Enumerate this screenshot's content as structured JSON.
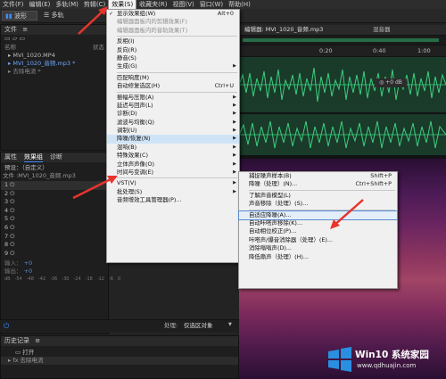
{
  "menubar": {
    "items": [
      {
        "label": "文件(F)"
      },
      {
        "label": "编辑(E)"
      },
      {
        "label": "多轨(M)"
      },
      {
        "label": "剪辑(C)"
      },
      {
        "label": "效果(S)"
      },
      {
        "label": "收藏夹(R)"
      },
      {
        "label": "视图(V)"
      },
      {
        "label": "窗口(W)"
      },
      {
        "label": "帮助(H)"
      }
    ]
  },
  "toolbar": {
    "waveform_label": "波形",
    "multitrack_label": "多轨"
  },
  "files_panel": {
    "title": "文件",
    "col_name": "名称",
    "col_status": "状态",
    "items": [
      "MVI_1020.MP4",
      "MVI_1020_音频.mp3 *",
      "去除电流 *"
    ]
  },
  "effects_panel": {
    "tabs": [
      "属性",
      "效果组",
      "诊断"
    ],
    "preset_label": "预设：（自定义）",
    "file_label": "文件 :MVI_1020_音频.mp3",
    "slots": [
      "1",
      "2",
      "3",
      "4",
      "5",
      "6",
      "7",
      "8",
      "9"
    ],
    "db_ticks": [
      "dB",
      "-54",
      "-48",
      "-42",
      "-36",
      "-30",
      "-24",
      "-18",
      "-12",
      "-6",
      "0"
    ],
    "process_label": "处理:",
    "process_value": "仅选区对象",
    "input_label": "输入：",
    "output_label": "输出：",
    "gain_value": "+0"
  },
  "history_panel": {
    "title": "历史记录",
    "items": [
      "打开",
      "去除电流"
    ]
  },
  "editor": {
    "tab1": "编辑器: MVI_1020_音频.mp3",
    "tab2": "混音器",
    "timecodes": [
      "0:20",
      "0:40",
      "1:00"
    ],
    "hud": "+0 dB"
  },
  "effects_menu": {
    "items": [
      {
        "label": "显示效果组(W)",
        "shortcut": "Alt+0",
        "check": "✓"
      },
      {
        "label": "编辑器面板内的剪辑效果(F)",
        "shortcut": "",
        "disabled": true
      },
      {
        "label": "编辑器面板内的音轨效果(T)",
        "shortcut": "",
        "disabled": true
      },
      {
        "sep": true
      },
      {
        "label": "反相(I)",
        "shortcut": ""
      },
      {
        "label": "反向(R)",
        "shortcut": ""
      },
      {
        "label": "静音(S)",
        "shortcut": ""
      },
      {
        "label": "生成(G)",
        "shortcut": "",
        "sub": true
      },
      {
        "sep": true
      },
      {
        "label": "匹配响度(M)",
        "shortcut": ""
      },
      {
        "label": "自动修复选区(H)",
        "shortcut": "Ctrl+U"
      },
      {
        "sep": true
      },
      {
        "label": "振幅与压限(A)",
        "shortcut": "",
        "sub": true
      },
      {
        "label": "延迟与回声(L)",
        "shortcut": "",
        "sub": true
      },
      {
        "label": "诊断(D)",
        "shortcut": "",
        "sub": true
      },
      {
        "label": "滤波与均衡(Q)",
        "shortcut": "",
        "sub": true
      },
      {
        "label": "调制(U)",
        "shortcut": "",
        "sub": true
      },
      {
        "label": "降噪/恢复(N)",
        "shortcut": "",
        "sub": true,
        "highlight": true
      },
      {
        "label": "混响(B)",
        "shortcut": "",
        "sub": true
      },
      {
        "label": "特殊效果(C)",
        "shortcut": "",
        "sub": true
      },
      {
        "label": "立体声声像(O)",
        "shortcut": "",
        "sub": true
      },
      {
        "label": "时间与变调(E)",
        "shortcut": "",
        "sub": true
      },
      {
        "sep": true
      },
      {
        "label": "VST(V)",
        "shortcut": "",
        "sub": true
      },
      {
        "label": "批处理(S)",
        "shortcut": "",
        "sub": true
      },
      {
        "label": "音频增效工具管理器(P)...",
        "shortcut": ""
      }
    ]
  },
  "noise_submenu": {
    "items": [
      {
        "label": "捕捉噪声样本(B)",
        "shortcut": "Shift+P"
      },
      {
        "label": "降噪（处理）(N)...",
        "shortcut": "Ctrl+Shift+P"
      },
      {
        "sep": true
      },
      {
        "label": "了解声音模型(L)",
        "shortcut": ""
      },
      {
        "label": "声音移除（处理）(S)...",
        "shortcut": ""
      },
      {
        "sep": true
      },
      {
        "label": "自适应降噪(A)...",
        "shortcut": "",
        "boxed": true
      },
      {
        "label": "自动咔嗒声移除(K)...",
        "shortcut": ""
      },
      {
        "label": "自动相位校正(P)...",
        "shortcut": ""
      },
      {
        "label": "咔嗒声/爆音消除器（处理）(E)...",
        "shortcut": ""
      },
      {
        "label": "消除嗡嗡声(D)...",
        "shortcut": ""
      },
      {
        "label": "降低嘶声（处理）(H)...",
        "shortcut": ""
      }
    ]
  },
  "watermark": {
    "title": "Win10 系统家园",
    "url": "www.qdhuajin.com"
  },
  "colors": {
    "arrow": "#e8352c",
    "accent_blue": "#3f8cff",
    "wave_green": "#2fae6a"
  }
}
